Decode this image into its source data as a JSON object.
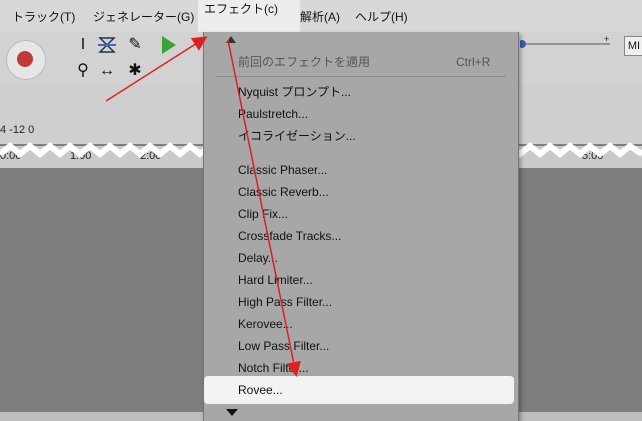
{
  "menubar": {
    "items": [
      "トラック(T)",
      "ジェネレーター(G)",
      "エフェクト(c)",
      "解析(A)",
      "ヘルプ(H)"
    ]
  },
  "toolbar": {
    "meter_numbers": "4  -12  0",
    "mi_label": "MI"
  },
  "timeline": {
    "labels": [
      "0:00",
      "1:00",
      "2:00",
      "5:00"
    ]
  },
  "effect_menu": {
    "repeat_last": "前回のエフェクトを適用",
    "repeat_shortcut": "Ctrl+R",
    "items": [
      "Nyquist プロンプト...",
      "Paulstretch...",
      "イコライゼーション...",
      "Classic Phaser...",
      "Classic Reverb...",
      "Clip Fix...",
      "Crossfade Tracks...",
      "Delay...",
      "Hard Limiter...",
      "High Pass Filter...",
      "Kerovee...",
      "Low Pass Filter...",
      "Notch Filter...",
      "Rovee..."
    ]
  },
  "colors": {
    "annotation_arrow": "#e02020",
    "record": "#c13a3a",
    "play": "#39a339"
  }
}
